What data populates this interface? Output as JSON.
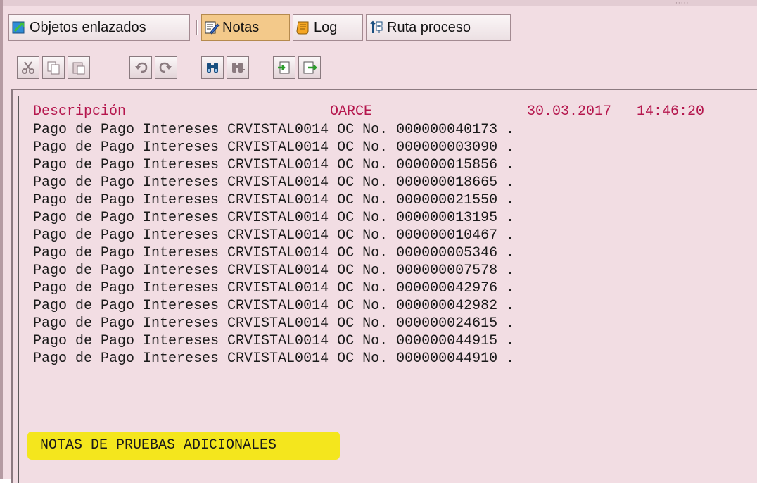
{
  "tabs": [
    {
      "label": "Objetos enlazados",
      "icon": "linked-objects-icon"
    },
    {
      "label": "Notas",
      "icon": "notes-icon"
    },
    {
      "label": "Log",
      "icon": "log-scroll-icon"
    },
    {
      "label": "Ruta proceso",
      "icon": "process-route-icon"
    }
  ],
  "toolbar": {
    "icons": [
      "cut-icon",
      "copy-icon",
      "paste-icon",
      "undo-icon",
      "redo-icon",
      "find-icon",
      "find-next-icon",
      "import-icon",
      "export-icon"
    ]
  },
  "note": {
    "header": {
      "label": "Descripción",
      "user": "OARCE",
      "date": "30.03.2017",
      "time": "14:46:20"
    },
    "lines": [
      "Pago de Pago Intereses CRVISTAL0014 OC No. 000000040173 .",
      "Pago de Pago Intereses CRVISTAL0014 OC No. 000000003090 .",
      "Pago de Pago Intereses CRVISTAL0014 OC No. 000000015856 .",
      "Pago de Pago Intereses CRVISTAL0014 OC No. 000000018665 .",
      "Pago de Pago Intereses CRVISTAL0014 OC No. 000000021550 .",
      "Pago de Pago Intereses CRVISTAL0014 OC No. 000000013195 .",
      "Pago de Pago Intereses CRVISTAL0014 OC No. 000000010467 .",
      "Pago de Pago Intereses CRVISTAL0014 OC No. 000000005346 .",
      "Pago de Pago Intereses CRVISTAL0014 OC No. 000000007578 .",
      "Pago de Pago Intereses CRVISTAL0014 OC No. 000000042976 .",
      "Pago de Pago Intereses CRVISTAL0014 OC No. 000000042982 .",
      "Pago de Pago Intereses CRVISTAL0014 OC No. 000000024615 .",
      "Pago de Pago Intereses CRVISTAL0014 OC No. 000000044915 .",
      "Pago de Pago Intereses CRVISTAL0014 OC No. 000000044910 ."
    ],
    "additional": "NOTAS DE PRUEBAS ADICIONALES"
  },
  "colors": {
    "background": "#f2dde3",
    "header_text": "#b5164d",
    "highlight": "#f3e612",
    "active_tab": "#f3c98a"
  }
}
